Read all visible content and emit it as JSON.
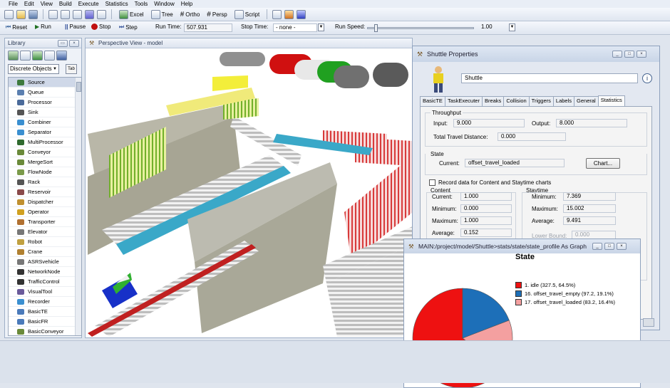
{
  "menu": [
    "File",
    "Edit",
    "View",
    "Build",
    "Execute",
    "Statistics",
    "Tools",
    "Window",
    "Help"
  ],
  "toolbar": {
    "excel": "Excel",
    "tree": "Tree",
    "ortho": "Ortho",
    "persp": "Persp",
    "script": "Script"
  },
  "run_toolbar": {
    "reset": "Reset",
    "run": "Run",
    "pause": "Pause",
    "stop": "Stop",
    "step": "Step",
    "run_time_label": "Run Time:",
    "run_time_value": "507.931",
    "stop_time_label": "Stop Time:",
    "stop_time_value": "- none -",
    "run_speed_label": "Run Speed:",
    "run_speed_value": "1.00"
  },
  "library": {
    "title": "Library",
    "category": "Discrete Objects",
    "tab_button": "Tab",
    "items": [
      {
        "label": "Source",
        "icon": "source-icon",
        "color": "#3d7a3d"
      },
      {
        "label": "Queue",
        "icon": "queue-icon",
        "color": "#5b7fb0"
      },
      {
        "label": "Processor",
        "icon": "processor-icon",
        "color": "#4a6a9a"
      },
      {
        "label": "Sink",
        "icon": "sink-icon",
        "color": "#555555"
      },
      {
        "label": "Combiner",
        "icon": "combiner-icon",
        "color": "#3a8fd0"
      },
      {
        "label": "Separator",
        "icon": "separator-icon",
        "color": "#3a8fd0"
      },
      {
        "label": "MultiProcessor",
        "icon": "multiprocessor-icon",
        "color": "#2f6a2f"
      },
      {
        "label": "Conveyor",
        "icon": "conveyor-icon",
        "color": "#6a8a3a"
      },
      {
        "label": "MergeSort",
        "icon": "mergesort-icon",
        "color": "#6a8a3a"
      },
      {
        "label": "FlowNode",
        "icon": "flownode-icon",
        "color": "#7a9a4a"
      },
      {
        "label": "Rack",
        "icon": "rack-icon",
        "color": "#555555"
      },
      {
        "label": "Reservoir",
        "icon": "reservoir-icon",
        "color": "#8a4a4a"
      },
      {
        "label": "Dispatcher",
        "icon": "dispatcher-icon",
        "color": "#c09030"
      },
      {
        "label": "Operator",
        "icon": "operator-icon",
        "color": "#d0a020"
      },
      {
        "label": "Transporter",
        "icon": "transporter-icon",
        "color": "#b07030"
      },
      {
        "label": "Elevator",
        "icon": "elevator-icon",
        "color": "#777777"
      },
      {
        "label": "Robot",
        "icon": "robot-icon",
        "color": "#c0a040"
      },
      {
        "label": "Crane",
        "icon": "crane-icon",
        "color": "#b08030"
      },
      {
        "label": "ASRSvehicle",
        "icon": "asrsvehicle-icon",
        "color": "#777777"
      },
      {
        "label": "NetworkNode",
        "icon": "networknode-icon",
        "color": "#333333"
      },
      {
        "label": "TrafficControl",
        "icon": "trafficcontrol-icon",
        "color": "#333333"
      },
      {
        "label": "VisualTool",
        "icon": "visualtool-icon",
        "color": "#6a5a9a"
      },
      {
        "label": "Recorder",
        "icon": "recorder-icon",
        "color": "#3a8fd0"
      },
      {
        "label": "BasicTE",
        "icon": "basicte-icon",
        "color": "#4a7aba"
      },
      {
        "label": "BasicFR",
        "icon": "basicfr-icon",
        "color": "#4a7aba"
      },
      {
        "label": "BasicConveyor",
        "icon": "basicconveyor-icon",
        "color": "#6a8a3a"
      }
    ]
  },
  "view": {
    "title": "Perspective View - model"
  },
  "properties": {
    "title": "Shuttle  Properties",
    "name": "Shuttle",
    "tabs": [
      "BasicTE",
      "TaskExecuter",
      "Breaks",
      "Collision",
      "Triggers",
      "Labels",
      "General",
      "Statistics"
    ],
    "active_tab": "Statistics",
    "throughput_label": "Throughput",
    "input_label": "Input:",
    "input_value": "9.000",
    "output_label": "Output:",
    "output_value": "8.000",
    "travel_label": "Total Travel Distance:",
    "travel_value": "0.000",
    "state_label": "State",
    "current_label": "Current:",
    "current_value": "offset_travel_loaded",
    "chart_button": "Chart...",
    "record_label": "Record data for Content and Staytime charts",
    "content_label": "Content",
    "content_current_label": "Current:",
    "content_current": "1.000",
    "content_min_label": "Minimum:",
    "content_min": "0.000",
    "content_max_label": "Maximum:",
    "content_max": "1.000",
    "content_avg_label": "Average:",
    "content_avg": "0.152",
    "staytime_label": "Staytime",
    "stay_min_label": "Minimum:",
    "stay_min": "7.369",
    "stay_max_label": "Maximum:",
    "stay_max": "15.002",
    "stay_avg_label": "Average:",
    "stay_avg": "9.491",
    "lower_bound_label": "Lower Bound:",
    "lower_bound_value": "0.000"
  },
  "graph": {
    "title": "MAIN:/project/model/Shuttle>stats/state/state_profile As Graph",
    "heading": "State",
    "legend": [
      "1. idle (327.5, 64.5%)",
      "16. offset_travel_empty (97.2, 19.1%)",
      "17. offset_travel_loaded (83.2, 16.4%)"
    ]
  },
  "chart_data": {
    "type": "pie",
    "title": "State",
    "categories": [
      "1. idle",
      "16. offset_travel_empty",
      "17. offset_travel_loaded"
    ],
    "values": [
      327.5,
      97.2,
      83.2
    ],
    "percent": [
      64.5,
      19.1,
      16.4
    ],
    "colors": [
      "#ee1111",
      "#1d6fb8",
      "#f4a0a0"
    ],
    "legend_position": "right"
  }
}
